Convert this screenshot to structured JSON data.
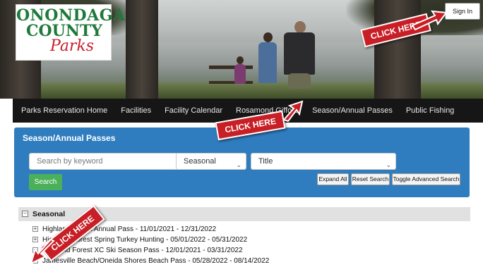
{
  "header": {
    "logo_line1": "ONONDAGA",
    "logo_line2": "COUNTY",
    "logo_line3": "Parks",
    "sign_in": "Sign In"
  },
  "nav": {
    "items": [
      {
        "label": "Parks Reservation Home"
      },
      {
        "label": "Facilities"
      },
      {
        "label": "Facility Calendar"
      },
      {
        "label": "Rosamond Gifford"
      },
      {
        "label": "Season/Annual Passes"
      },
      {
        "label": "Public Fishing"
      }
    ]
  },
  "panel": {
    "title": "Season/Annual Passes",
    "search_placeholder": "Search by keyword",
    "type_select": "Seasonal",
    "sort_select": "Title",
    "search_button": "Search",
    "expand_all": "Expand All",
    "reset_search": "Reset Search",
    "toggle_advanced": "Toggle Advanced Search"
  },
  "list": {
    "group": "Seasonal",
    "items": [
      {
        "label": "Highland Forest Annual Pass - 11/01/2021 - 12/31/2022"
      },
      {
        "label": "Highland Forest Spring Turkey Hunting - 05/01/2022 - 05/31/2022"
      },
      {
        "label": "Highland Forest XC Ski Season Pass - 12/01/2021 - 03/31/2022"
      },
      {
        "label": "Jamesville Beach/Oneida Shores Beach Pass - 05/28/2022 - 08/14/2022"
      }
    ]
  },
  "annotations": {
    "click_here": "CLICK HERE",
    "color": "#c81f26"
  },
  "colors": {
    "panel_blue": "#2f7dbf",
    "search_green": "#4bb05a",
    "nav_bg": "#161616",
    "logo_green": "#1e7a3a",
    "logo_red": "#c7202f"
  }
}
